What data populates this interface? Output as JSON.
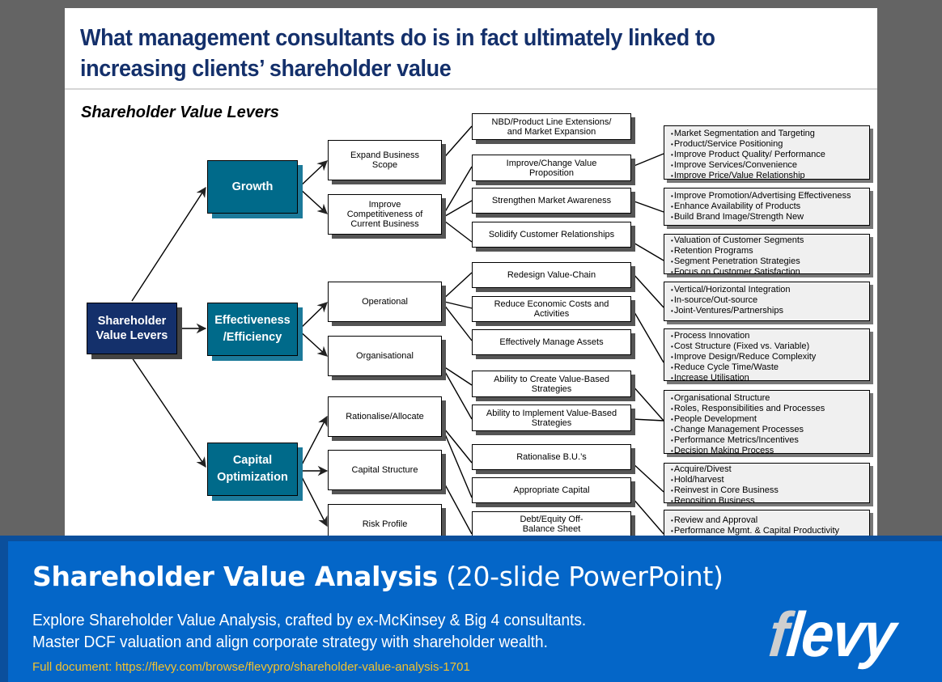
{
  "slide": {
    "title": "What management consultants do is in fact ultimately linked to increasing clients’ shareholder value",
    "subtitle": "Shareholder Value Levers"
  },
  "diagram": {
    "root": "Shareholder Value Levers",
    "levers": [
      {
        "label": "Growth",
        "drivers": [
          "Expand Business Scope",
          "Improve Competitiveness of Current Business"
        ]
      },
      {
        "label": "Effectiveness /Efficiency",
        "drivers": [
          "Operational",
          "Organisational"
        ]
      },
      {
        "label": "Capital Optimization",
        "drivers": [
          "Rationalise/Allocate",
          "Capital Structure",
          "Risk Profile"
        ]
      }
    ],
    "actions": [
      "NBD/Product Line Extensions/ and Market Expansion",
      "Improve/Change Value Proposition",
      "Strengthen Market Awareness",
      "Solidify Customer Relationships",
      "Redesign Value-Chain",
      "Reduce Economic Costs and Activities",
      "Effectively Manage Assets",
      "Ability to Create Value-Based Strategies",
      "Ability to Implement Value-Based Strategies",
      "Rationalise B.U.’s",
      "Appropriate Capital",
      "Debt/Equity Off-Balance Sheet"
    ],
    "details": [
      [
        "Market Segmentation and Targeting",
        "Product/Service Positioning",
        "Improve Product Quality/ Performance",
        "Improve Services/Convenience",
        "Improve Price/Value Relationship"
      ],
      [
        "Improve Promotion/Advertising  Effectiveness",
        "Enhance Availability of Products",
        "Build Brand Image/Strength New"
      ],
      [
        "Valuation of Customer Segments",
        "Retention Programs",
        "Segment Penetration Strategies",
        "Focus on Customer Satisfaction"
      ],
      [
        "Vertical/Horizontal Integration",
        "In-source/Out-source",
        "Joint-Ventures/Partnerships"
      ],
      [
        "Process Innovation",
        "Cost Structure (Fixed vs. Variable)",
        "Improve Design/Reduce Complexity",
        "Reduce Cycle Time/Waste",
        "Increase Utilisation"
      ],
      [
        "Organisational Structure",
        "Roles, Responsibilities and Processes",
        "People Development",
        "Change Management Processes",
        "Performance Metrics/Incentives",
        "Decision Making Process"
      ],
      [
        "Acquire/Divest",
        "Hold/harvest",
        "Reinvest in Core Business",
        "Reposition Business"
      ],
      [
        "Review and Approval",
        "Performance Mgmt. & Capital Productivity"
      ]
    ]
  },
  "banner": {
    "title_bold": "Shareholder Value Analysis",
    "title_light": " (20-slide PowerPoint)",
    "description": "Explore Shareholder Value Analysis, crafted by ex-McKinsey & Big 4 consultants. Master DCF valuation and align corporate strategy with shareholder wealth.",
    "link": "Full document: https://flevy.com/browse/flevypro/shareholder-value-analysis-1701",
    "logo_first": "f",
    "logo_rest": "levy"
  },
  "colors": {
    "title": "#14306b",
    "root_box": "#14306b",
    "lever_box": "#006a8a",
    "banner": "#0466c8",
    "link": "#f2c12e"
  }
}
